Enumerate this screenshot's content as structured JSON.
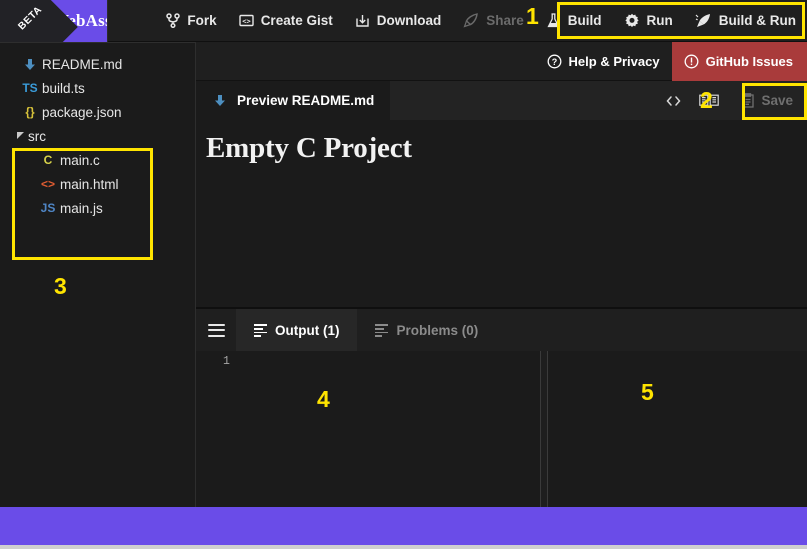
{
  "brand": {
    "name": "WebAssembly Studio",
    "badge": "BETA",
    "color": "#6a4ce8"
  },
  "toolbar": {
    "menu_icon": "hamburger-menu-icon",
    "items": [
      {
        "label": "Fork",
        "icon": "git-fork-icon",
        "disabled": false
      },
      {
        "label": "Create Gist",
        "icon": "code-brackets-icon",
        "disabled": false
      },
      {
        "label": "Download",
        "icon": "download-icon",
        "disabled": false
      },
      {
        "label": "Share",
        "icon": "rocket-icon",
        "disabled": true
      },
      {
        "label": "Build",
        "icon": "flask-icon",
        "disabled": false
      },
      {
        "label": "Run",
        "icon": "gear-icon",
        "disabled": false
      },
      {
        "label": "Build & Run",
        "icon": "rocket-run-icon",
        "disabled": false
      }
    ]
  },
  "helpbar": {
    "items": [
      {
        "label": "Help & Privacy",
        "icon": "question-circle-icon",
        "style": "normal"
      },
      {
        "label": "GitHub Issues",
        "icon": "exclamation-circle-icon",
        "style": "danger",
        "color": "#a93b3b"
      }
    ]
  },
  "sidebar": {
    "files": [
      {
        "label": "README.md",
        "icon": "markdown-arrow-icon",
        "icon_text": "⬇",
        "icon_class": "c-blue",
        "indent": 1,
        "type": "file"
      },
      {
        "label": "build.ts",
        "icon": "typescript-icon",
        "icon_text": "TS",
        "icon_class": "c-ts",
        "indent": 1,
        "type": "file"
      },
      {
        "label": "package.json",
        "icon": "json-icon",
        "icon_text": "{}",
        "icon_class": "c-json",
        "indent": 1,
        "type": "file"
      },
      {
        "label": "src",
        "icon": "folder-expanded-icon",
        "icon_text": "◢",
        "icon_class": "c-blue",
        "indent": 0,
        "type": "folder"
      },
      {
        "label": "main.c",
        "icon": "c-file-icon",
        "icon_text": "C",
        "icon_class": "c-c",
        "indent": 2,
        "type": "file"
      },
      {
        "label": "main.html",
        "icon": "html-file-icon",
        "icon_text": "<>",
        "icon_class": "c-html",
        "indent": 2,
        "type": "file"
      },
      {
        "label": "main.js",
        "icon": "javascript-file-icon",
        "icon_text": "JS",
        "icon_class": "c-js",
        "indent": 2,
        "type": "file"
      }
    ]
  },
  "editor": {
    "tab": {
      "label": "Preview README.md",
      "icon": "markdown-arrow-icon",
      "active": true
    },
    "actions": [
      {
        "name": "view-source-icon",
        "glyph": "<>"
      },
      {
        "name": "split-view-icon",
        "glyph": "▤▤"
      }
    ],
    "save": {
      "label": "Save",
      "icon": "save-clipboard-icon",
      "disabled": true
    },
    "document": {
      "heading": "Empty C Project"
    }
  },
  "panel": {
    "menu_icon": "hamburger-menu-icon",
    "tabs": [
      {
        "label": "Output (1)",
        "icon": "lines-icon",
        "active": true
      },
      {
        "label": "Problems (0)",
        "icon": "lines-icon",
        "active": false
      }
    ],
    "output": {
      "line_number": "1",
      "content": ""
    }
  },
  "annotations": [
    {
      "number": "1",
      "target": "build-run-button-group"
    },
    {
      "number": "2",
      "target": "editor-save-button"
    },
    {
      "number": "3",
      "target": "src-folder-tree"
    },
    {
      "number": "4",
      "target": "output-console-left"
    },
    {
      "number": "5",
      "target": "output-console-right"
    }
  ],
  "colors": {
    "accent": "#6a4ce8",
    "annotation": "#ffe400",
    "danger": "#a93b3b",
    "background": "#1b1b1b"
  }
}
